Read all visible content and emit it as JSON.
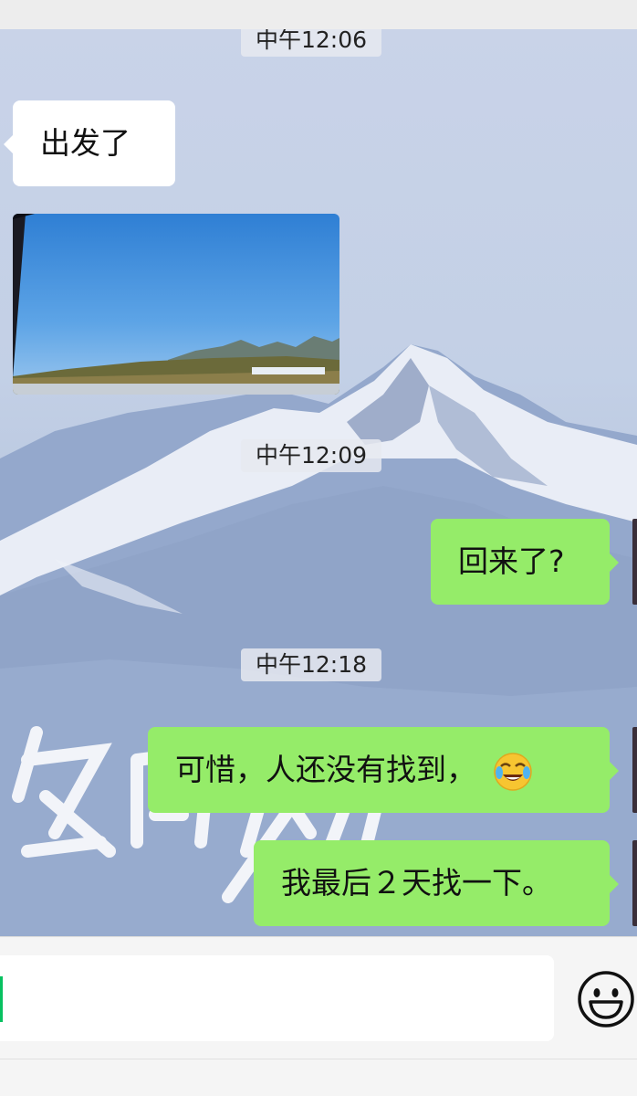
{
  "chat": {
    "messages": [
      {
        "type": "timestamp",
        "text": "中午12:06"
      },
      {
        "type": "text",
        "side": "left",
        "text": "出发了"
      },
      {
        "type": "image",
        "side": "left",
        "description": "landscape-photo"
      },
      {
        "type": "timestamp",
        "text": "中午12:09"
      },
      {
        "type": "text",
        "side": "right",
        "text": "回来了?"
      },
      {
        "type": "timestamp",
        "text": "中午12:18"
      },
      {
        "type": "text",
        "side": "right",
        "text": "可惜，人还没有找到，",
        "emoji": "tears-of-joy-icon"
      },
      {
        "type": "text",
        "side": "right",
        "text": "我最后２天找一下。"
      }
    ]
  },
  "colors": {
    "sent_bubble": "#95ec69",
    "received_bubble": "#ffffff",
    "cursor": "#07c160"
  },
  "input_bar": {
    "value": "",
    "emoji_button_icon": "smiley-face-icon"
  }
}
